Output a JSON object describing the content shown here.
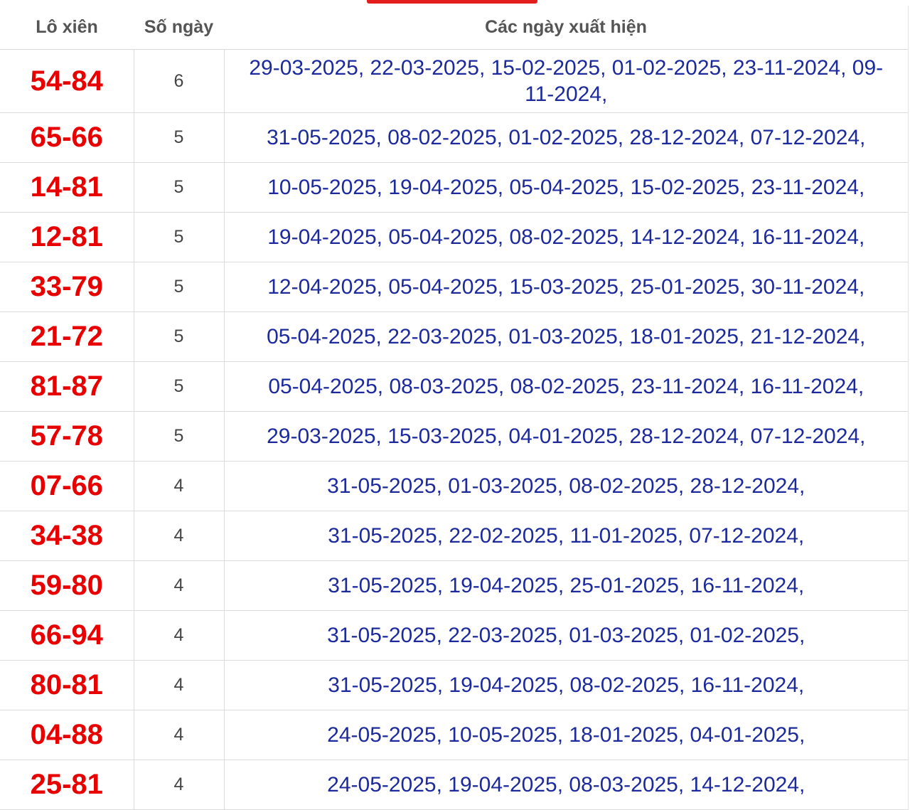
{
  "header": {
    "col_pair": "Lô xiên",
    "col_count": "Số ngày",
    "col_dates": "Các ngày xuất hiện"
  },
  "rows": [
    {
      "pair": "54-84",
      "count": "6",
      "dates": "29-03-2025, 22-03-2025, 15-02-2025, 01-02-2025, 23-11-2024, 09-11-2024,"
    },
    {
      "pair": "65-66",
      "count": "5",
      "dates": "31-05-2025, 08-02-2025, 01-02-2025, 28-12-2024, 07-12-2024,"
    },
    {
      "pair": "14-81",
      "count": "5",
      "dates": "10-05-2025, 19-04-2025, 05-04-2025, 15-02-2025, 23-11-2024,"
    },
    {
      "pair": "12-81",
      "count": "5",
      "dates": "19-04-2025, 05-04-2025, 08-02-2025, 14-12-2024, 16-11-2024,"
    },
    {
      "pair": "33-79",
      "count": "5",
      "dates": "12-04-2025, 05-04-2025, 15-03-2025, 25-01-2025, 30-11-2024,"
    },
    {
      "pair": "21-72",
      "count": "5",
      "dates": "05-04-2025, 22-03-2025, 01-03-2025, 18-01-2025, 21-12-2024,"
    },
    {
      "pair": "81-87",
      "count": "5",
      "dates": "05-04-2025, 08-03-2025, 08-02-2025, 23-11-2024, 16-11-2024,"
    },
    {
      "pair": "57-78",
      "count": "5",
      "dates": "29-03-2025, 15-03-2025, 04-01-2025, 28-12-2024, 07-12-2024,"
    },
    {
      "pair": "07-66",
      "count": "4",
      "dates": "31-05-2025, 01-03-2025, 08-02-2025, 28-12-2024,"
    },
    {
      "pair": "34-38",
      "count": "4",
      "dates": "31-05-2025, 22-02-2025, 11-01-2025, 07-12-2024,"
    },
    {
      "pair": "59-80",
      "count": "4",
      "dates": "31-05-2025, 19-04-2025, 25-01-2025, 16-11-2024,"
    },
    {
      "pair": "66-94",
      "count": "4",
      "dates": "31-05-2025, 22-03-2025, 01-03-2025, 01-02-2025,"
    },
    {
      "pair": "80-81",
      "count": "4",
      "dates": "31-05-2025, 19-04-2025, 08-02-2025, 16-11-2024,"
    },
    {
      "pair": "04-88",
      "count": "4",
      "dates": "24-05-2025, 10-05-2025, 18-01-2025, 04-01-2025,"
    },
    {
      "pair": "25-81",
      "count": "4",
      "dates": "24-05-2025, 19-04-2025, 08-03-2025, 14-12-2024,"
    }
  ]
}
